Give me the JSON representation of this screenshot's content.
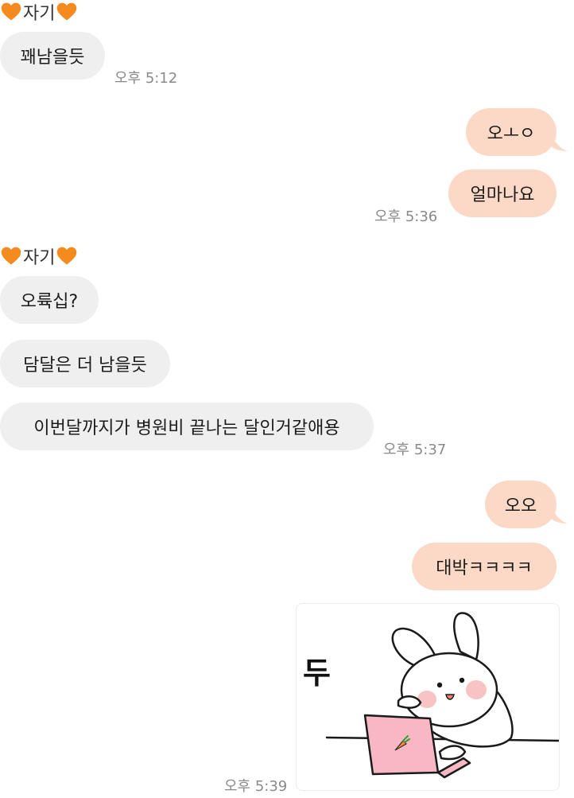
{
  "contact": {
    "name": "자기"
  },
  "groups": [
    {
      "sender": "자기"
    },
    {
      "sender": "자기"
    }
  ],
  "messages": [
    {
      "text": "꽤남을듯",
      "direction": "incoming"
    },
    {
      "text": "오ㅗㅇ",
      "direction": "outgoing"
    },
    {
      "text": "얼마나요",
      "direction": "outgoing"
    },
    {
      "text": "오륙십?",
      "direction": "incoming"
    },
    {
      "text": "담달은 더 남을듯",
      "direction": "incoming"
    },
    {
      "text": "이번달까지가 병원비 끝나는 달인거같애용",
      "direction": "incoming"
    },
    {
      "text": "오오",
      "direction": "outgoing"
    },
    {
      "text": "대박ㅋㅋㅋㅋ",
      "direction": "outgoing"
    }
  ],
  "timestamps": [
    "오후 5:12",
    "오후 5:36",
    "오후 5:37",
    "오후 5:39"
  ],
  "sticker": {
    "text": "두",
    "icon": "bunny-laptop-sticker"
  },
  "colors": {
    "incoming_bubble": "#efefef",
    "outgoing_bubble": "#fcd9c7",
    "heart": "#f58a1f",
    "timestamp": "#8a8a8a"
  }
}
